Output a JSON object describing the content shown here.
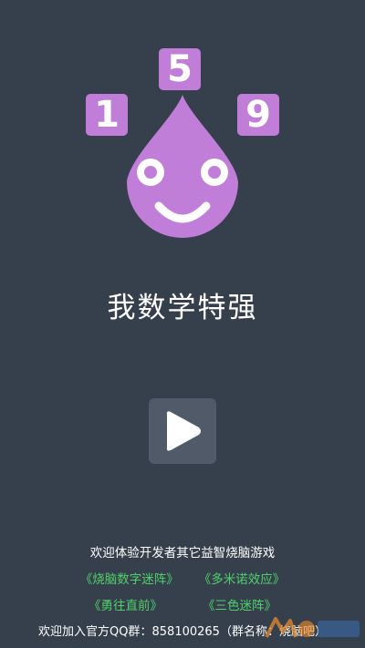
{
  "logo": {
    "tiles": [
      "1",
      "5",
      "9"
    ],
    "drop_color": "#c17ed8"
  },
  "title": "我数学特强",
  "play_button": {
    "icon": "play-icon"
  },
  "footer": {
    "promo": "欢迎体验开发者其它益智烧脑游戏",
    "games": [
      "《烧脑数字迷阵》",
      "《多米诺效应》",
      "《勇往直前》",
      "《三色迷阵》"
    ],
    "qq_group": "欢迎加入官方QQ群：858100265（群名称：烧脑吧）"
  },
  "colors": {
    "background": "#36404c",
    "accent": "#c17ed8",
    "link": "#4ed16a",
    "button_bg": "#505a68"
  }
}
